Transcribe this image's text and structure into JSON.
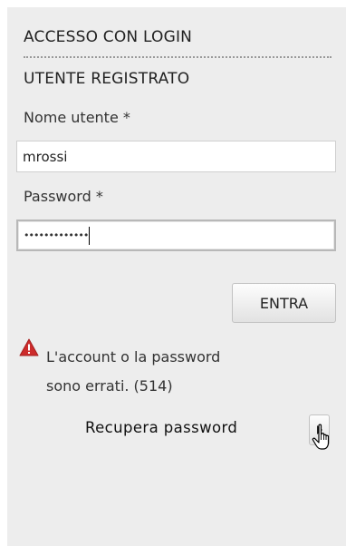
{
  "login": {
    "title": "ACCESSO CON LOGIN",
    "subtitle": "UTENTE REGISTRATO",
    "username_label": "Nome utente *",
    "username_value": "mrossi",
    "password_label": "Password *",
    "password_mask": "•••••••••••••",
    "submit_label": "ENTRA"
  },
  "error": {
    "icon": "warning-triangle-icon",
    "message_line1": "L'account o la password",
    "message_line2": "sono errati. (514)",
    "color": "#cc2b2b"
  },
  "recover": {
    "label": "Recupera password",
    "button_icon": "play-arrow-icon"
  },
  "cursor": {
    "icon": "hand-pointer-icon"
  }
}
